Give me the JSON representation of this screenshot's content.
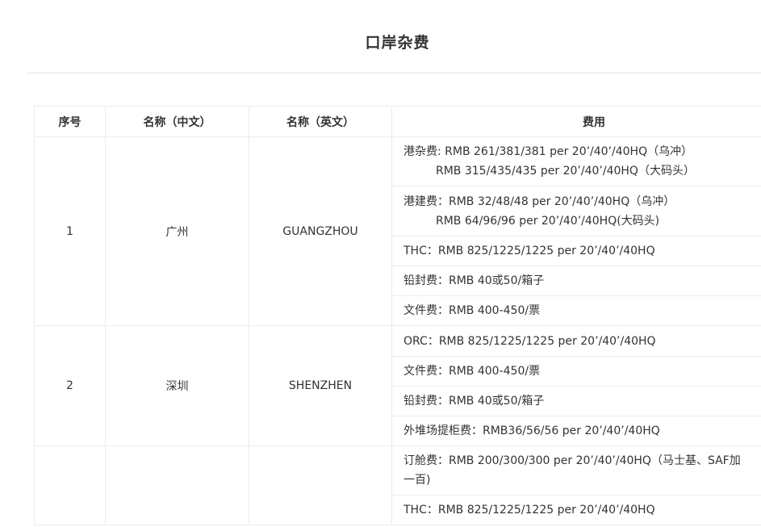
{
  "page": {
    "title": "口岸杂费"
  },
  "table": {
    "headers": [
      "序号",
      "名称（中文）",
      "名称（英文）",
      "费用"
    ],
    "rows": [
      {
        "no": "1",
        "cn": "广州",
        "en": "GUANGZHOU",
        "fees": [
          {
            "line1": "港杂费: RMB 261/381/381 per 20’/40’/40HQ（乌冲）",
            "line2": "RMB 315/435/435 per 20’/40’/40HQ（大码头）"
          },
          {
            "line1": "港建费：RMB 32/48/48 per 20’/40’/40HQ（乌冲）",
            "line2": "RMB 64/96/96 per 20’/40’/40HQ(大码头)"
          },
          {
            "line1": "THC：RMB 825/1225/1225 per 20’/40’/40HQ"
          },
          {
            "line1": "铅封费：RMB 40或50/箱子"
          },
          {
            "line1": "文件费：RMB 400-450/票"
          }
        ]
      },
      {
        "no": "2",
        "cn": "深圳",
        "en": "SHENZHEN",
        "fees": [
          {
            "line1": "ORC：RMB 825/1225/1225 per 20’/40’/40HQ"
          },
          {
            "line1": "文件费：RMB 400-450/票"
          },
          {
            "line1": "铅封费：RMB 40或50/箱子"
          },
          {
            "line1": "外堆场提柜费：RMB36/56/56 per 20’/40’/40HQ"
          }
        ]
      },
      {
        "no": "",
        "cn": "",
        "en": "",
        "fees": [
          {
            "line1": "订舱费：RMB 200/300/300 per 20’/40’/40HQ（马士基、SAF加",
            "line2": "一百)"
          },
          {
            "line1": "THC：RMB 825/1225/1225 per 20’/40’/40HQ"
          }
        ]
      }
    ]
  }
}
